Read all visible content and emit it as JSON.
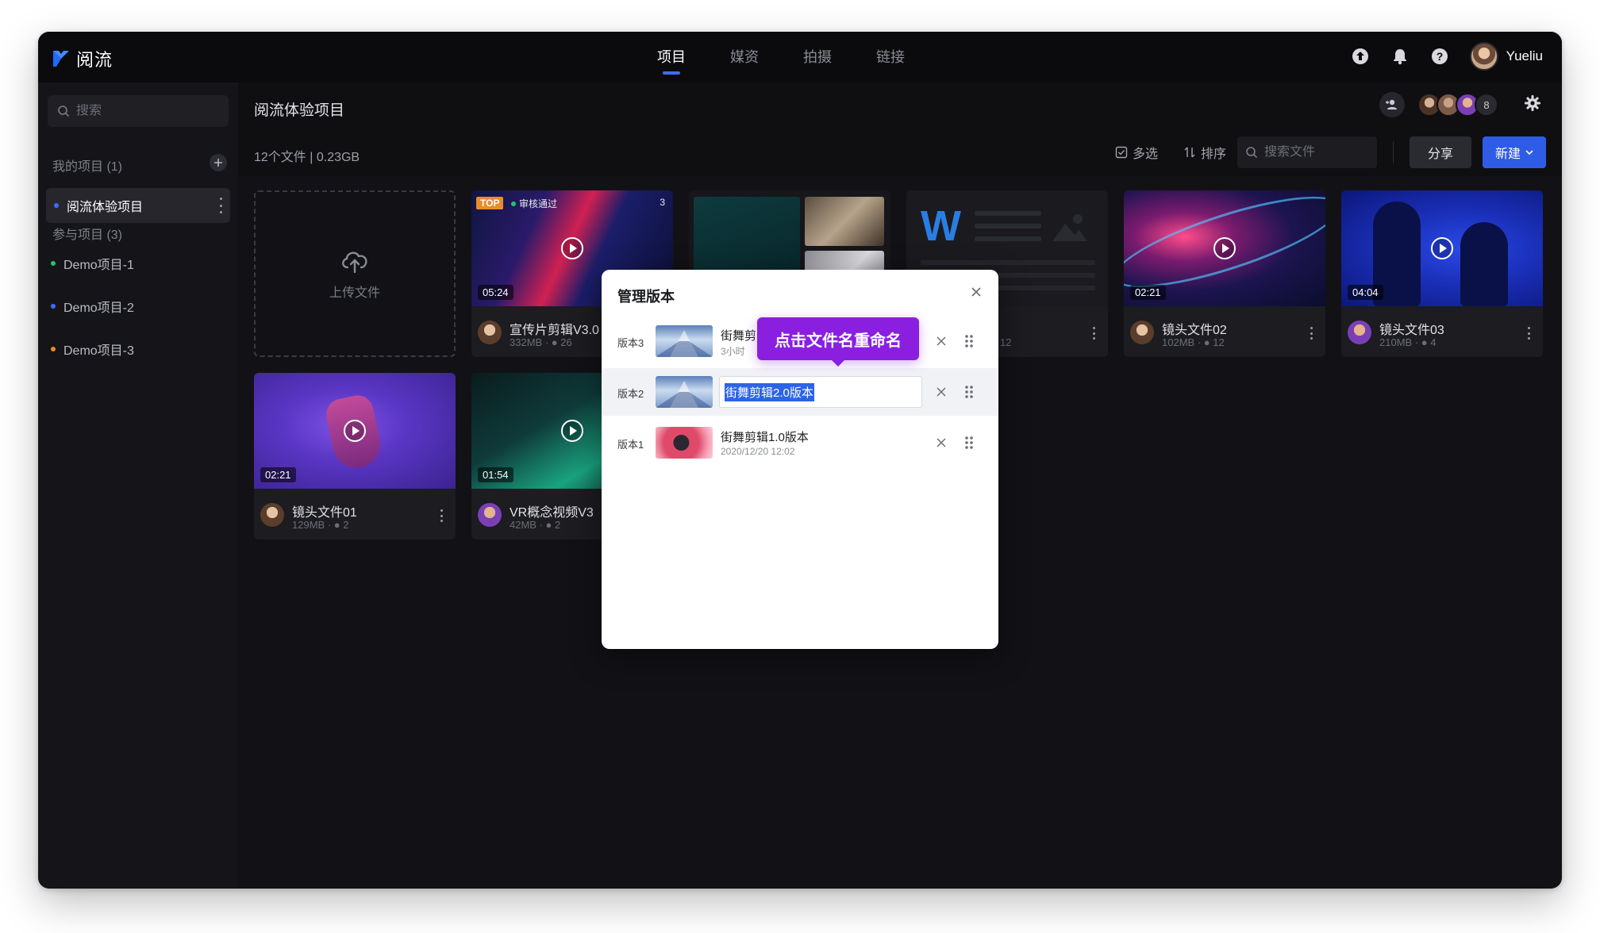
{
  "app": {
    "name": "阅流"
  },
  "nav": {
    "tabs": [
      "项目",
      "媒资",
      "拍摄",
      "链接"
    ],
    "active_index": 0
  },
  "user": {
    "name": "Yueliu"
  },
  "sidebar": {
    "search_placeholder": "搜索",
    "my_projects_title": "我的项目 (1)",
    "my_projects": [
      {
        "label": "阅流体验项目",
        "dot_color": "#3f6bff"
      }
    ],
    "joined_projects_title": "参与项目 (3)",
    "joined_projects": [
      {
        "label": "Demo项目-1",
        "dot_color": "#27c46a"
      },
      {
        "label": "Demo项目-2",
        "dot_color": "#3f6bff"
      },
      {
        "label": "Demo项目-3",
        "dot_color": "#f08a24"
      }
    ]
  },
  "project": {
    "title": "阅流体验项目",
    "meta": "12个文件  |  0.23GB",
    "member_count": "8"
  },
  "toolbar": {
    "multiselect": "多选",
    "sort": "排序",
    "search_placeholder": "搜索文件",
    "share": "分享",
    "new": "新建"
  },
  "upload": {
    "label": "上传文件"
  },
  "cards": [
    {
      "name": "宣传片剪辑V3.0",
      "size": "332MB",
      "comments": "26",
      "duration": "05:24",
      "badge_top": "TOP",
      "badge_status": "审核通过",
      "badge_count": "3"
    },
    {
      "name": "",
      "size": "",
      "comments": "",
      "duration": ""
    },
    {
      "name": "",
      "size": "",
      "comments": "12",
      "duration": ""
    },
    {
      "name": "镜头文件02",
      "size": "102MB",
      "comments": "12",
      "duration": "02:21"
    },
    {
      "name": "镜头文件03",
      "size": "210MB",
      "comments": "4",
      "duration": "04:04"
    },
    {
      "name": "镜头文件01",
      "size": "129MB",
      "comments": "2",
      "duration": "02:21"
    },
    {
      "name": "VR概念视频V3",
      "size": "42MB",
      "comments": "2",
      "duration": "01:54"
    }
  ],
  "doc_card": {
    "letter": "W"
  },
  "modal": {
    "title": "管理版本",
    "tooltip": "点击文件名重命名",
    "versions": [
      {
        "label": "版本3",
        "name": "街舞剪",
        "date": "3小时",
        "suffix": "··"
      },
      {
        "label": "版本2",
        "name": "街舞剪辑2.0版本",
        "date": ""
      },
      {
        "label": "版本1",
        "name": "街舞剪辑1.0版本",
        "date": "2020/12/20 12:02"
      }
    ]
  },
  "colors": {
    "accent": "#3f6bff",
    "primary_button": "#2f5ce6",
    "tooltip": "#8a1fe0",
    "top_badge": "#e98c2a",
    "status_ok": "#27c46a"
  }
}
